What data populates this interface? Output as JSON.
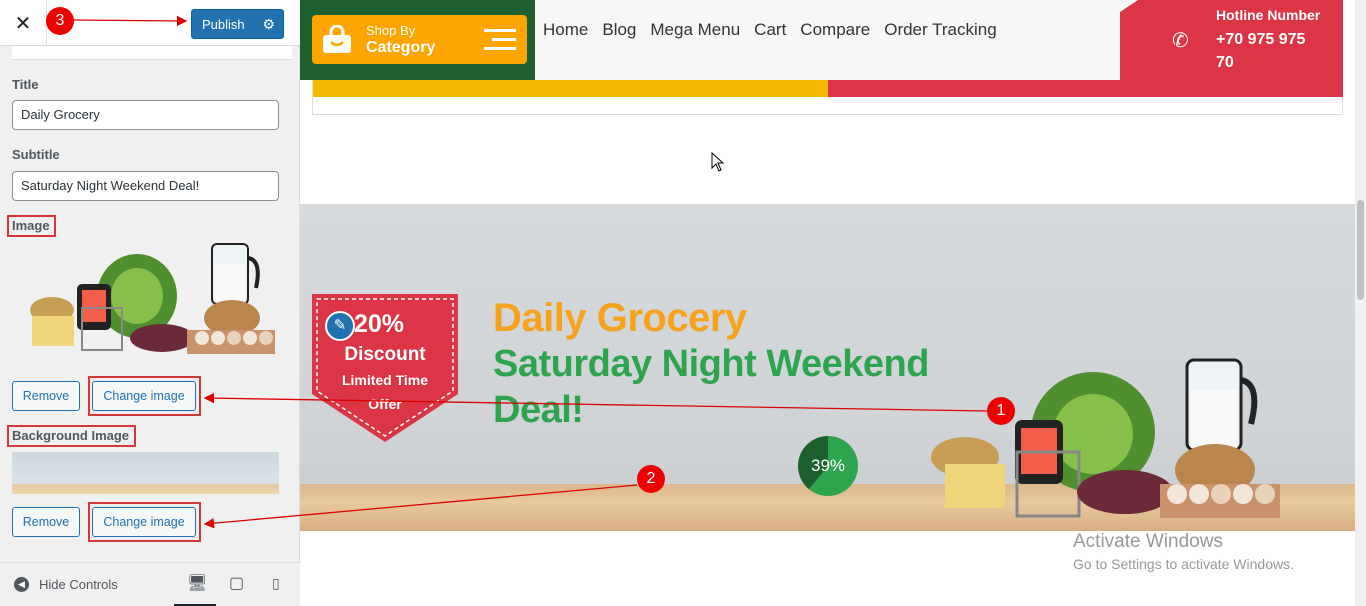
{
  "sidebar": {
    "close_icon": "close-icon",
    "publish_label": "Publish",
    "title_label": "Title",
    "title_value": "Daily Grocery",
    "subtitle_label": "Subtitle",
    "subtitle_value": "Saturday Night Weekend Deal!",
    "image_label": "Image",
    "remove_label": "Remove",
    "change_image_label": "Change image",
    "bg_image_label": "Background Image",
    "hide_controls_label": "Hide Controls"
  },
  "nav": {
    "shop_by": "Shop By",
    "category": "Category",
    "menu": [
      "Home",
      "Blog",
      "Mega Menu",
      "Cart",
      "Compare",
      "Order Tracking"
    ],
    "hotline_title": "Hotline Number",
    "hotline_number": "+70 975 975 70"
  },
  "banner": {
    "badge_percent": "20%",
    "badge_discount": "Discount",
    "badge_limited": "Limited Time",
    "badge_offer": "Offer",
    "title": "Daily Grocery",
    "subtitle": "Saturday Night Weekend Deal!",
    "progress_label": "39%",
    "progress_value": 0.39
  },
  "annotations": [
    "1",
    "2",
    "3"
  ],
  "watermark": {
    "line1": "Activate Windows",
    "line2": "Go to Settings to activate Windows."
  },
  "colors": {
    "wp_blue": "#2271b1",
    "category_orange": "#fea500",
    "dark_green": "#1e5f2e",
    "red": "#dc3545",
    "title_orange": "#f7a21b",
    "subtitle_green": "#2ea44f"
  }
}
